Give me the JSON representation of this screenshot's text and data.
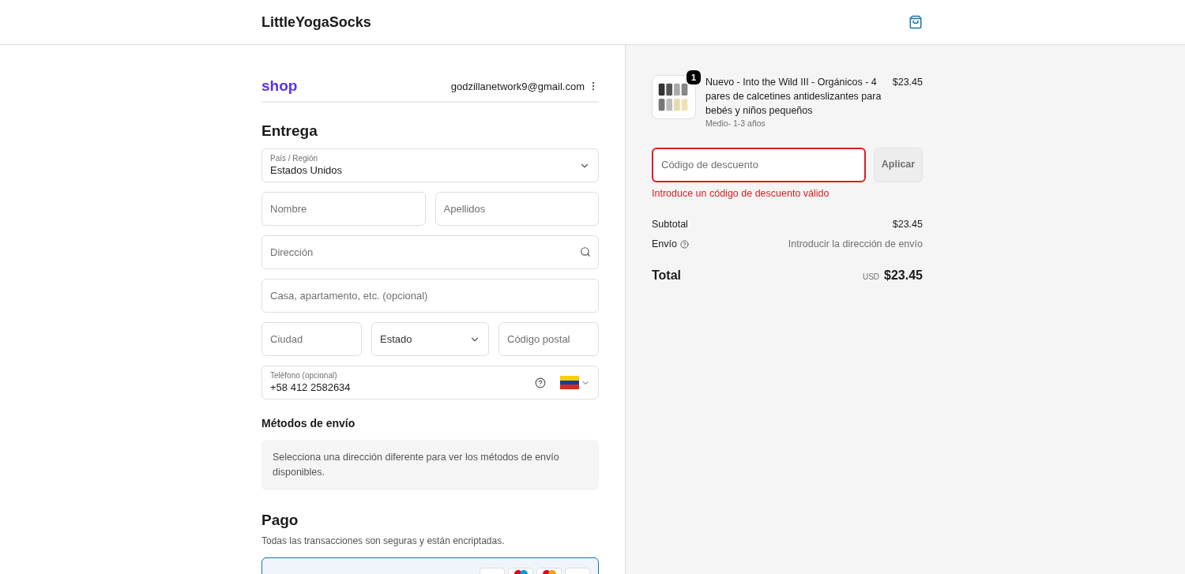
{
  "header": {
    "store_name": "LittleYogaSocks"
  },
  "account": {
    "logo": "shop",
    "email": "godzillanetwork9@gmail.com"
  },
  "delivery": {
    "title": "Entrega",
    "country": {
      "label": "País / Región",
      "value": "Estados Unidos"
    },
    "first_name": {
      "placeholder": "Nombre"
    },
    "last_name": {
      "placeholder": "Apellidos"
    },
    "address": {
      "placeholder": "Dirección"
    },
    "apartment": {
      "placeholder": "Casa, apartamento, etc. (opcional)"
    },
    "city": {
      "placeholder": "Ciudad"
    },
    "state": {
      "placeholder": "Estado"
    },
    "postal_code": {
      "placeholder": "Código postal"
    },
    "phone": {
      "label": "Teléfono (opcional)",
      "value": "+58 412 2582634"
    }
  },
  "shipping_methods": {
    "title": "Métodos de envío",
    "message": "Selecciona una dirección diferente para ver los métodos de envío disponibles."
  },
  "payment": {
    "title": "Pago",
    "subtitle": "Todas las transacciones son seguras y están encriptadas."
  },
  "summary": {
    "item": {
      "quantity": "1",
      "name": "Nuevo - Into the Wild III - Orgánicos - 4 pares de calcetines antideslizantes para bebés y niños pequeños",
      "variant": "Medio- 1-3 años",
      "price": "$23.45"
    },
    "discount": {
      "placeholder": "Código de descuento",
      "invalid": true,
      "button": "Aplicar",
      "error": "Introduce un código de descuento válido"
    },
    "subtotal": {
      "label": "Subtotal",
      "value": "$23.45"
    },
    "shipping": {
      "label": "Envío",
      "value": "Introducir la dirección de envío"
    },
    "total": {
      "label": "Total",
      "currency": "USD",
      "value": "$23.45"
    }
  }
}
